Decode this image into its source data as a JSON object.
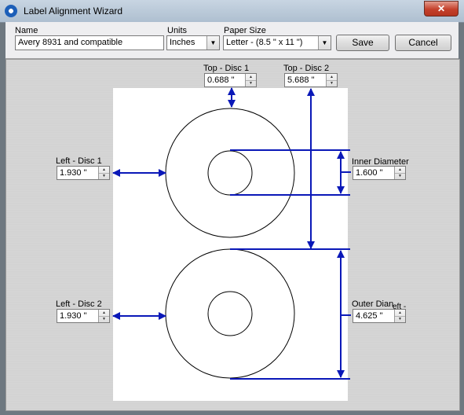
{
  "window": {
    "title": "Label Alignment Wizard",
    "close_glyph": "✕",
    "app_icon": "app-disc-icon"
  },
  "toolbar": {
    "name_label": "Name",
    "name_value": "Avery 8931 and compatible",
    "units_label": "Units",
    "units_value": "Inches",
    "paper_size_label": "Paper Size",
    "paper_size_value": "Letter - (8.5 \" x 11 \")",
    "save_label": "Save",
    "cancel_label": "Cancel"
  },
  "fields": {
    "top_disc1": {
      "label": "Top - Disc 1",
      "value": "0.688 \""
    },
    "top_disc2": {
      "label": "Top - Disc 2",
      "value": "5.688 \""
    },
    "left_disc1": {
      "label": "Left - Disc 1",
      "value": "1.930 \""
    },
    "left_disc2": {
      "label": "Left - Disc 2",
      "value": "1.930 \""
    },
    "inner_diameter": {
      "label": "Inner Diameter",
      "value": "1.600 \""
    },
    "outer_diameter": {
      "label": "Outer Dian",
      "label_overlap": "eft -",
      "value": "4.625 \""
    }
  },
  "colors": {
    "arrow": "#0a18b8",
    "disc_outline": "#000000",
    "close_button": "#c4402b"
  }
}
